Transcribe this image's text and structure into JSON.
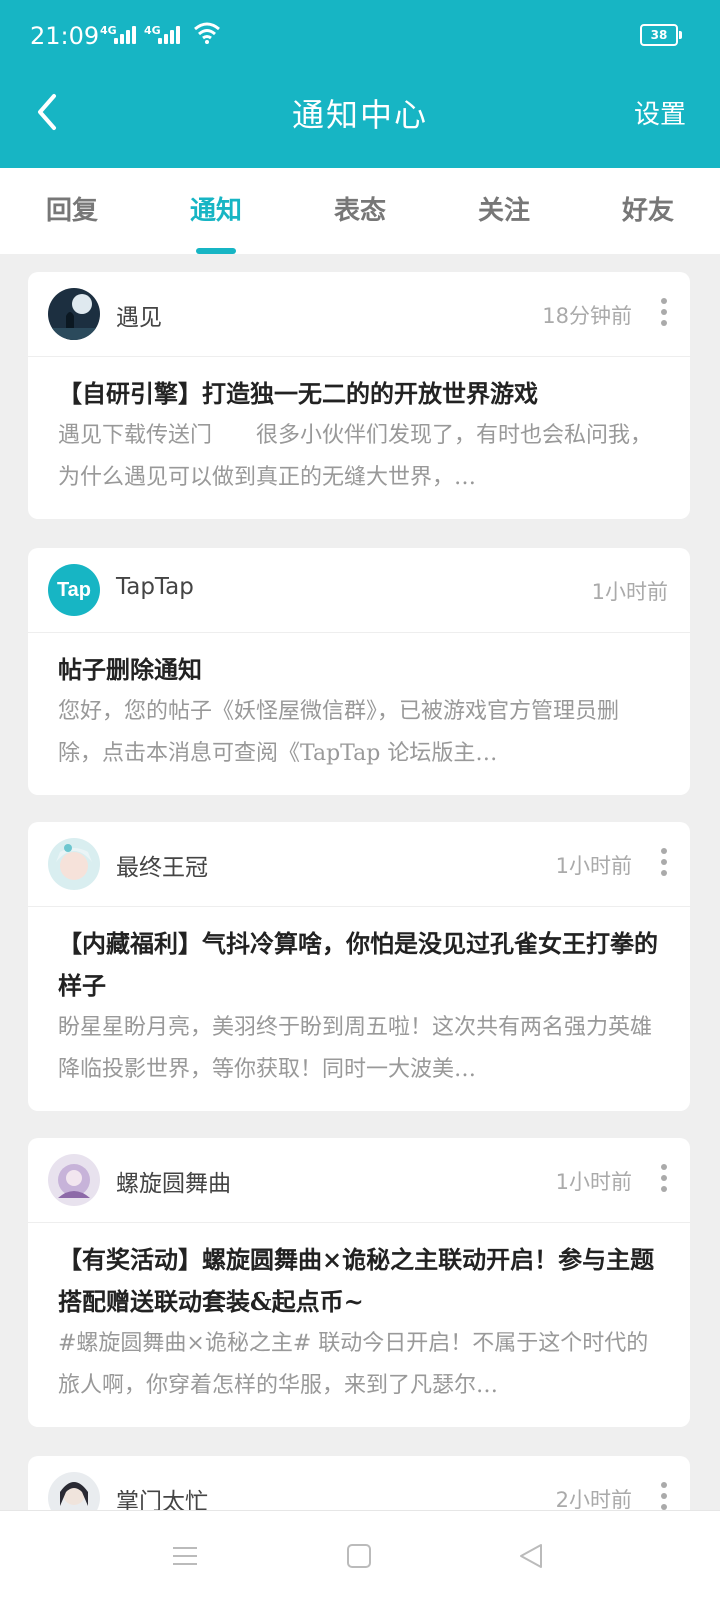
{
  "status_bar": {
    "time": "21:09",
    "network1": "4G",
    "network2": "4G",
    "battery": "38"
  },
  "header": {
    "title": "通知中心",
    "settings_label": "设置"
  },
  "tabs": [
    {
      "label": "回复",
      "active": false
    },
    {
      "label": "通知",
      "active": true
    },
    {
      "label": "表态",
      "active": false
    },
    {
      "label": "关注",
      "active": false
    },
    {
      "label": "好友",
      "active": false
    }
  ],
  "notifications": [
    {
      "user": "遇见",
      "time": "18分钟前",
      "title": "【自研引擎】打造独一无二的的开放世界游戏",
      "desc": "遇见下载传送门　　很多小伙伴们发现了，有时也会私问我，为什么遇见可以做到真正的无缝大世界，…"
    },
    {
      "user": "TapTap",
      "avatar_text": "Tap",
      "time": "1小时前",
      "title": "帖子删除通知",
      "desc": "您好，您的帖子《妖怪屋微信群》，已被游戏官方管理员删除，点击本消息可查阅《TapTap 论坛版主…"
    },
    {
      "user": "最终王冠",
      "time": "1小时前",
      "title": "【内藏福利】气抖冷算啥，你怕是没见过孔雀女王打拳的样子",
      "desc": "盼星星盼月亮，美羽终于盼到周五啦！这次共有两名强力英雄降临投影世界，等你获取！同时一大波美…"
    },
    {
      "user": "螺旋圆舞曲",
      "time": "1小时前",
      "title": "【有奖活动】螺旋圆舞曲×诡秘之主联动开启！参与主题搭配赠送联动套装&起点币~",
      "desc": "#螺旋圆舞曲×诡秘之主# 联动今日开启！不属于这个时代的旅人啊，你穿着怎样的华服，来到了凡瑟尔…"
    },
    {
      "user": "掌门太忙",
      "time": "2小时前"
    }
  ],
  "colors": {
    "accent": "#17b5c4"
  }
}
